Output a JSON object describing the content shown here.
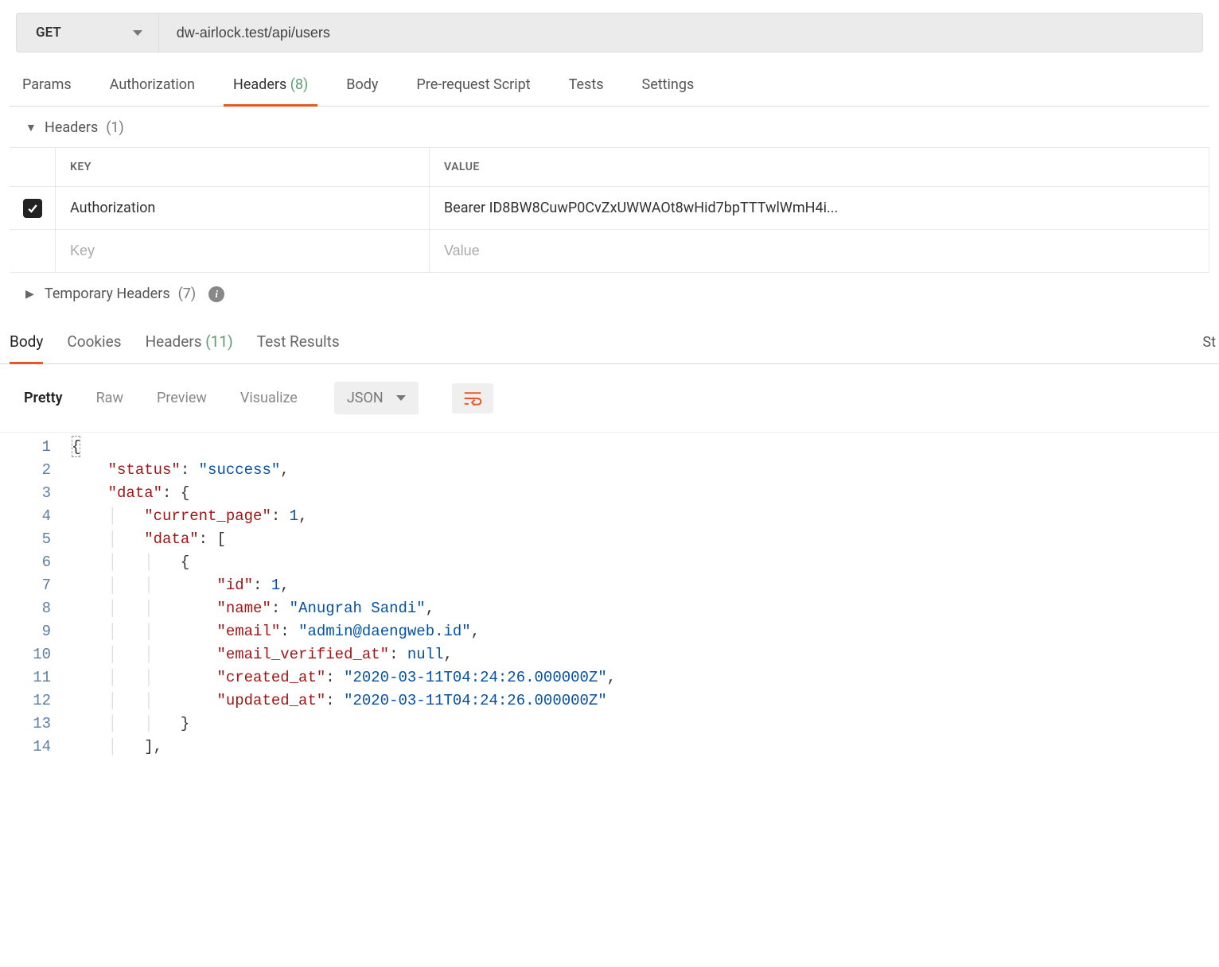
{
  "request": {
    "method": "GET",
    "url": "dw-airlock.test/api/users"
  },
  "request_tabs": {
    "params": "Params",
    "authorization": "Authorization",
    "headers": "Headers",
    "headers_count": "(8)",
    "body": "Body",
    "prerequest": "Pre-request Script",
    "tests": "Tests",
    "settings": "Settings"
  },
  "headers_section": {
    "title": "Headers",
    "count": "(1)",
    "col_key": "KEY",
    "col_value": "VALUE",
    "rows": [
      {
        "key": "Authorization",
        "value": "Bearer ID8BW8CuwP0CvZxUWWAOt8wHid7bpTTTwlWmH4i..."
      }
    ],
    "key_placeholder": "Key",
    "value_placeholder": "Value"
  },
  "temp_headers": {
    "title": "Temporary Headers",
    "count": "(7)"
  },
  "response_tabs": {
    "body": "Body",
    "cookies": "Cookies",
    "headers": "Headers",
    "headers_count": "(11)",
    "test_results": "Test Results",
    "status_label": "St"
  },
  "view_options": {
    "pretty": "Pretty",
    "raw": "Raw",
    "preview": "Preview",
    "visualize": "Visualize",
    "format": "JSON"
  },
  "json_body": {
    "l1": "{",
    "l2_key": "\"status\"",
    "l2_val": "\"success\"",
    "l3_key": "\"data\"",
    "l4_key": "\"current_page\"",
    "l4_val": "1",
    "l5_key": "\"data\"",
    "l7_key": "\"id\"",
    "l7_val": "1",
    "l8_key": "\"name\"",
    "l8_val": "\"Anugrah Sandi\"",
    "l9_key": "\"email\"",
    "l9_val": "\"admin@daengweb.id\"",
    "l10_key": "\"email_verified_at\"",
    "l10_val": "null",
    "l11_key": "\"created_at\"",
    "l11_val": "\"2020-03-11T04:24:26.000000Z\"",
    "l12_key": "\"updated_at\"",
    "l12_val": "\"2020-03-11T04:24:26.000000Z\""
  },
  "line_numbers": [
    "1",
    "2",
    "3",
    "4",
    "5",
    "6",
    "7",
    "8",
    "9",
    "10",
    "11",
    "12",
    "13",
    "14"
  ]
}
